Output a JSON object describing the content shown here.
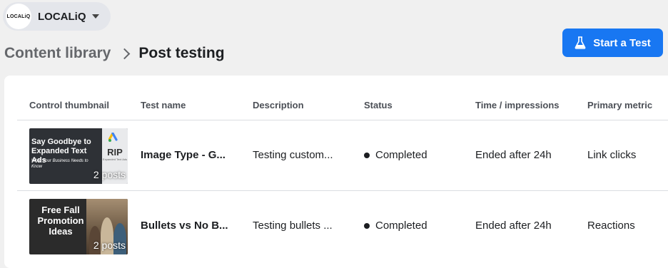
{
  "account": {
    "logo_text": "LOCALiQ",
    "name": "LOCALiQ"
  },
  "breadcrumb": {
    "parent": "Content library",
    "current": "Post testing"
  },
  "actions": {
    "start_test_label": "Start a Test"
  },
  "table": {
    "columns": [
      "Control thumbnail",
      "Test name",
      "Description",
      "Status",
      "Time / impressions",
      "Primary metric"
    ],
    "rows": [
      {
        "thumbnail": {
          "title": "Say Goodbye to Expanded Text Ads",
          "subtitle": "What Your Business Needs to Know",
          "side_label": "RIP",
          "side_small": "Expanded Text Ads",
          "posts": "2 posts"
        },
        "test_name": "Image Type - G...",
        "description": "Testing custom...",
        "status": "Completed",
        "time": "Ended after 24h",
        "metric": "Link clicks"
      },
      {
        "thumbnail": {
          "title": "Free Fall Promotion Ideas",
          "posts": "2 posts"
        },
        "test_name": "Bullets vs No B...",
        "description": "Testing bullets ...",
        "status": "Completed",
        "time": "Ended after 24h",
        "metric": "Reactions"
      }
    ]
  },
  "colors": {
    "primary_button": "#1877f2",
    "background": "#f0f0f0"
  }
}
